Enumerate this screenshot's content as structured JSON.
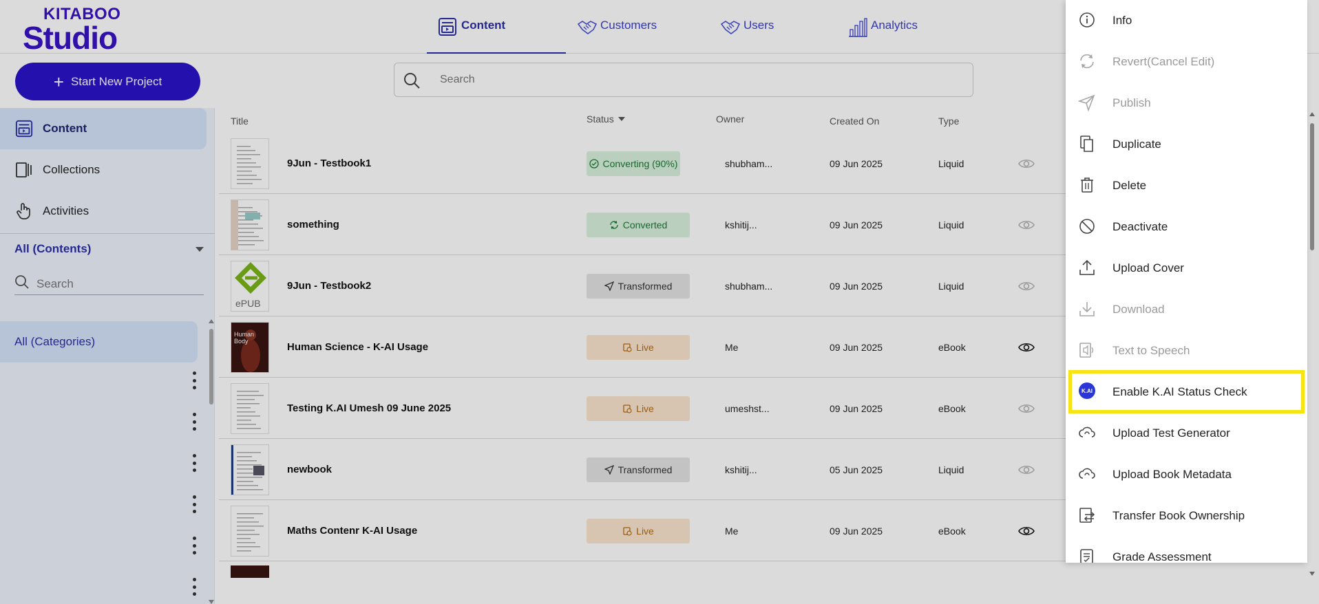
{
  "colors": {
    "brand": "#2b13c9",
    "brand_accent": "#c1159f",
    "highlight": "#f6e413"
  },
  "logo": {
    "top": "KITABOO",
    "bottom": "Studio"
  },
  "nav": {
    "tabs": [
      {
        "label": "Content",
        "icon": "content-icon",
        "active": true
      },
      {
        "label": "Customers",
        "icon": "handshake-icon",
        "active": false
      },
      {
        "label": "Users",
        "icon": "handshake-icon",
        "active": false
      },
      {
        "label": "Analytics",
        "icon": "bar-chart-icon",
        "active": false
      }
    ]
  },
  "toolbar": {
    "new_project_label": "Start New Project",
    "search_placeholder": "Search"
  },
  "sidebar": {
    "items": [
      {
        "label": "Content",
        "icon": "content-icon",
        "active": true
      },
      {
        "label": "Collections",
        "icon": "collections-icon",
        "active": false
      },
      {
        "label": "Activities",
        "icon": "hand-pointer-icon",
        "active": false
      }
    ],
    "filter_label": "All (Contents)",
    "search_placeholder": "Search",
    "category_label": "All (Categories)"
  },
  "table": {
    "headers": {
      "title": "Title",
      "status": "Status",
      "owner": "Owner",
      "created": "Created On",
      "type": "Type"
    },
    "rows": [
      {
        "title": "9Jun - Testbook1",
        "status": "Converting (90%)",
        "status_kind": "converting",
        "owner": "shubham...",
        "created": "09 Jun 2025",
        "type": "Liquid",
        "eye_active": false
      },
      {
        "title": "something",
        "status": "Converted",
        "status_kind": "converted",
        "owner": "kshitij...",
        "created": "09 Jun 2025",
        "type": "Liquid",
        "eye_active": false
      },
      {
        "title": "9Jun - Testbook2",
        "status": "Transformed",
        "status_kind": "transformed",
        "owner": "shubham...",
        "created": "09 Jun 2025",
        "type": "Liquid",
        "eye_active": false,
        "thumb_text": "ePUB"
      },
      {
        "title": "Human Science - K-AI Usage",
        "status": "Live",
        "status_kind": "live",
        "owner": "Me",
        "created": "09 Jun 2025",
        "type": "eBook",
        "eye_active": true,
        "thumb_text": "Human Body"
      },
      {
        "title": "Testing K.AI Umesh 09 June 2025",
        "status": "Live",
        "status_kind": "live",
        "owner": "umeshst...",
        "created": "09 Jun 2025",
        "type": "eBook",
        "eye_active": false
      },
      {
        "title": "newbook",
        "status": "Transformed",
        "status_kind": "transformed",
        "owner": "kshitij...",
        "created": "05 Jun 2025",
        "type": "Liquid",
        "eye_active": false
      },
      {
        "title": "Maths Contenr K-AI Usage",
        "status": "Live",
        "status_kind": "live",
        "owner": "Me",
        "created": "09 Jun 2025",
        "type": "eBook",
        "eye_active": true
      }
    ]
  },
  "menu": {
    "items": [
      {
        "label": "Info",
        "icon": "info-icon",
        "disabled": false
      },
      {
        "label": "Revert(Cancel Edit)",
        "icon": "revert-icon",
        "disabled": true
      },
      {
        "label": "Publish",
        "icon": "send-icon",
        "disabled": true
      },
      {
        "label": "Duplicate",
        "icon": "duplicate-icon",
        "disabled": false
      },
      {
        "label": "Delete",
        "icon": "trash-icon",
        "disabled": false
      },
      {
        "label": "Deactivate",
        "icon": "block-icon",
        "disabled": false
      },
      {
        "label": "Upload Cover",
        "icon": "upload-icon",
        "disabled": false
      },
      {
        "label": "Download",
        "icon": "download-icon",
        "disabled": true
      },
      {
        "label": "Text to Speech",
        "icon": "text-to-speech-icon",
        "disabled": true
      },
      {
        "label": "Enable K.AI Status Check",
        "icon": "kai-icon",
        "disabled": false,
        "highlighted": true,
        "badge": "K.AI"
      },
      {
        "label": "Upload Test Generator",
        "icon": "cloud-sync-icon",
        "disabled": false
      },
      {
        "label": "Upload Book Metadata",
        "icon": "cloud-sync-icon",
        "disabled": false
      },
      {
        "label": "Transfer Book Ownership",
        "icon": "transfer-icon",
        "disabled": false
      },
      {
        "label": "Grade Assessment",
        "icon": "grade-icon",
        "disabled": false
      }
    ]
  }
}
